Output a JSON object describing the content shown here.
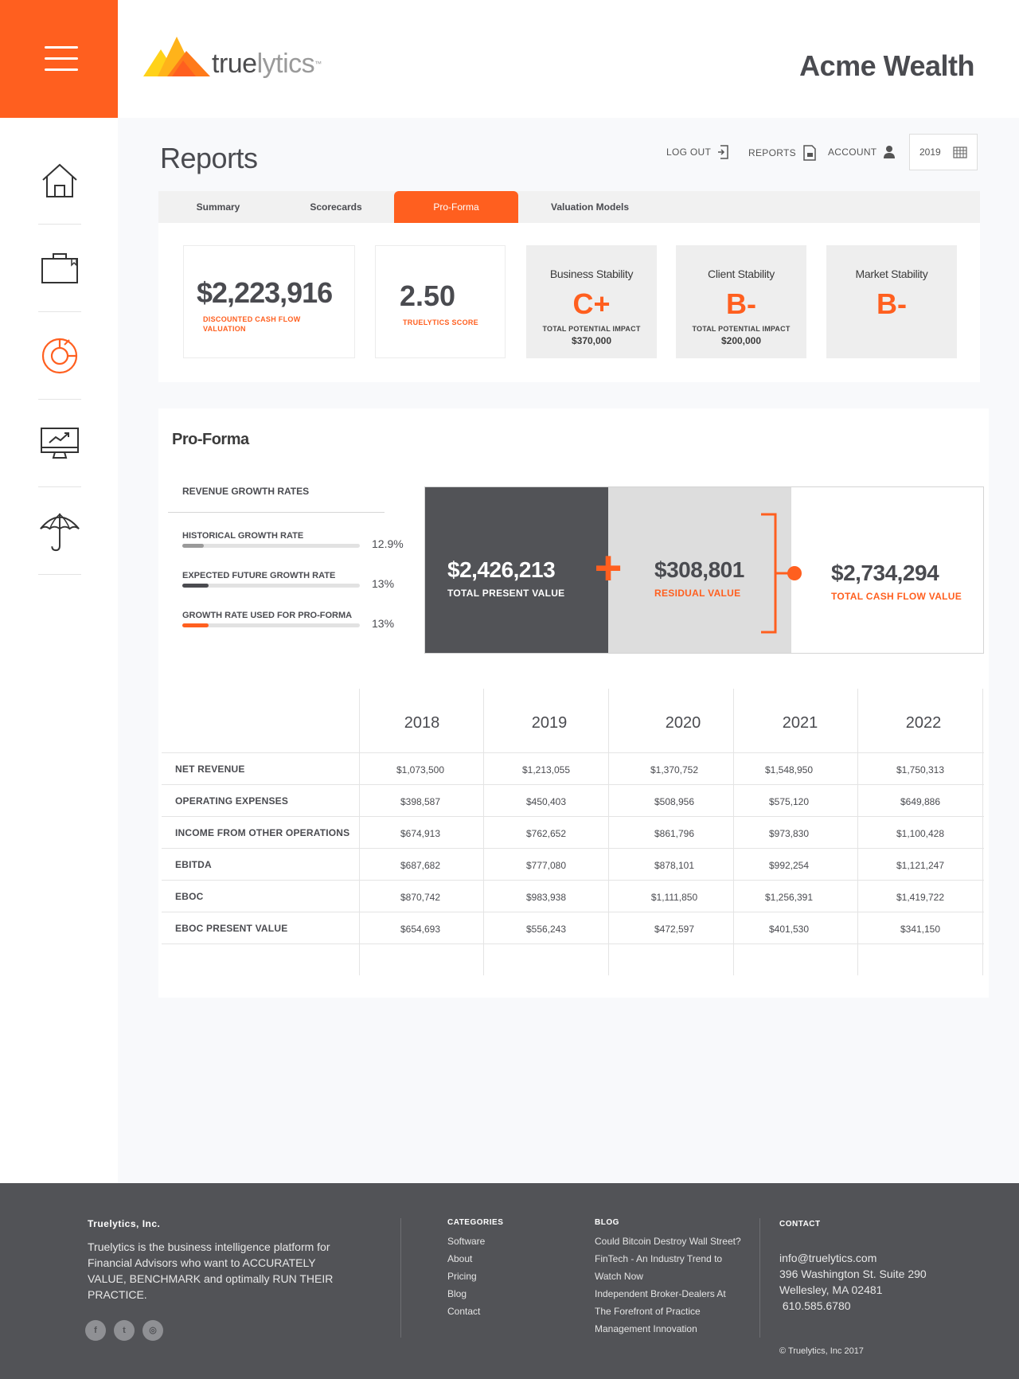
{
  "brand": {
    "logo_main": "true",
    "logo_light": "lytics",
    "logo_tm": "™",
    "company": "Acme Wealth",
    "accent": "#ff5f1f",
    "dark": "#525357"
  },
  "sidebar": {
    "items": [
      {
        "icon": "home-icon"
      },
      {
        "icon": "briefcase-icon"
      },
      {
        "icon": "pie-chart-icon"
      },
      {
        "icon": "monitor-chart-icon"
      },
      {
        "icon": "umbrella-icon"
      }
    ]
  },
  "page": {
    "title": "Reports"
  },
  "topnav": {
    "logout": "LOG OUT",
    "reports": "REPORTS",
    "account": "ACCOUNT",
    "year": "2019"
  },
  "tabs": [
    {
      "label": "Summary"
    },
    {
      "label": "Scorecards"
    },
    {
      "label": "Pro-Forma"
    },
    {
      "label": "Valuation Models"
    }
  ],
  "cards": {
    "dcf": {
      "value": "$2,223,916",
      "label": "DISCOUNTED CASH FLOW VALUATION"
    },
    "score": {
      "value": "2.50",
      "label": "TRUELYTICS SCORE"
    },
    "stability": [
      {
        "title": "Business Stability",
        "grade": "C+",
        "impact_label": "TOTAL POTENTIAL IMPACT",
        "impact": "$370,000"
      },
      {
        "title": "Client Stability",
        "grade": "B-",
        "impact_label": "TOTAL POTENTIAL IMPACT",
        "impact": "$200,000"
      },
      {
        "title": "Market Stability",
        "grade": "B-",
        "impact_label": "",
        "impact": ""
      }
    ]
  },
  "proforma": {
    "title": "Pro-Forma",
    "growth_heading": "REVENUE GROWTH RATES",
    "rates": [
      {
        "label": "HISTORICAL GROWTH RATE",
        "value": "12.9%",
        "fill": 0.12,
        "color": "#9a9a9a"
      },
      {
        "label": "EXPECTED FUTURE GROWTH RATE",
        "value": "13%",
        "fill": 0.15,
        "color": "#4a4b50"
      },
      {
        "label": "GROWTH RATE USED FOR PRO-FORMA",
        "value": "13%",
        "fill": 0.15,
        "color": "#ff5f1f"
      }
    ],
    "present": {
      "value": "$2,426,213",
      "label": "TOTAL PRESENT VALUE"
    },
    "plus": "+",
    "residual": {
      "value": "$308,801",
      "label": "RESIDUAL VALUE"
    },
    "total": {
      "value": "$2,734,294",
      "label": "TOTAL CASH FLOW VALUE"
    }
  },
  "table": {
    "years": [
      "2018",
      "2019",
      "2020",
      "2021",
      "2022"
    ],
    "rows": [
      {
        "label": "NET REVENUE",
        "values": [
          "$1,073,500",
          "$1,213,055",
          "$1,370,752",
          "$1,548,950",
          "$1,750,313"
        ]
      },
      {
        "label": "OPERATING EXPENSES",
        "values": [
          "$398,587",
          "$450,403",
          "$508,956",
          "$575,120",
          "$649,886"
        ]
      },
      {
        "label": "INCOME FROM OTHER OPERATIONS",
        "values": [
          "$674,913",
          "$762,652",
          "$861,796",
          "$973,830",
          "$1,100,428"
        ]
      },
      {
        "label": "EBITDA",
        "values": [
          "$687,682",
          "$777,080",
          "$878,101",
          "$992,254",
          "$1,121,247"
        ]
      },
      {
        "label": "EBOC",
        "values": [
          "$870,742",
          "$983,938",
          "$1,111,850",
          "$1,256,391",
          "$1,419,722"
        ]
      },
      {
        "label": "EBOC PRESENT VALUE",
        "values": [
          "$654,693",
          "$556,243",
          "$472,597",
          "$401,530",
          "$341,150"
        ]
      }
    ]
  },
  "footer": {
    "company": "Truelytics, Inc.",
    "about": "Truelytics is the business intelligence platform for Financial Advisors who want to ACCURATELY VALUE, BENCHMARK and optimally RUN THEIR PRACTICE.",
    "social": [
      {
        "icon": "facebook-icon",
        "glyph": "f"
      },
      {
        "icon": "twitter-icon",
        "glyph": "t"
      },
      {
        "icon": "dribbble-icon",
        "glyph": "◎"
      }
    ],
    "categories_heading": "CATEGORIES",
    "categories": [
      "Software",
      "About",
      "Pricing",
      "Blog",
      "Contact"
    ],
    "blog_heading": "BLOG",
    "blog": [
      "Could Bitcoin Destroy Wall Street?",
      "FinTech - An Industry Trend to",
      "Watch Now",
      "Independent Broker-Dealers At",
      "The Forefront of Practice",
      "Management Innovation"
    ],
    "contact_heading": "CONTACT",
    "contact": [
      "info@truelytics.com",
      "396 Washington St. Suite 290",
      "Wellesley, MA 02481",
      " 610.585.6780"
    ],
    "copyright": "© Truelytics, Inc  2017"
  }
}
